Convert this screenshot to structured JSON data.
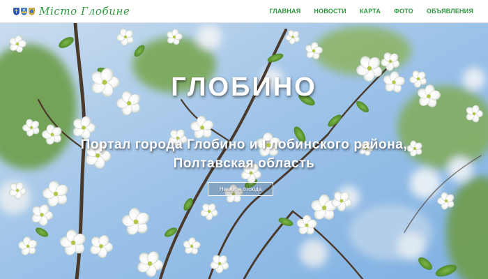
{
  "header": {
    "site_title": "Місто Глобине",
    "emblem_icons": [
      "coat-of-arms-icon",
      "city-emblem-icon",
      "district-emblem-icon"
    ]
  },
  "nav": {
    "items": [
      {
        "label": "ГЛАВНАЯ"
      },
      {
        "label": "НОВОСТИ"
      },
      {
        "label": "КАРТА"
      },
      {
        "label": "ФОТО"
      },
      {
        "label": "ОБЪЯВЛЕНИЯ"
      }
    ]
  },
  "hero": {
    "title": "ГЛОБИНО",
    "subtitle_line1": "Портал города Глобино и Глобинского района,",
    "subtitle_line2": "Полтавская область",
    "button_label": "Начните отсюда",
    "background": "photo of white cherry blossoms against a blue sky"
  },
  "colors": {
    "accent": "#2e9a3e",
    "header_bg": "#ffffff",
    "hero_text": "#ffffff",
    "sky": "#a9c9e6"
  }
}
